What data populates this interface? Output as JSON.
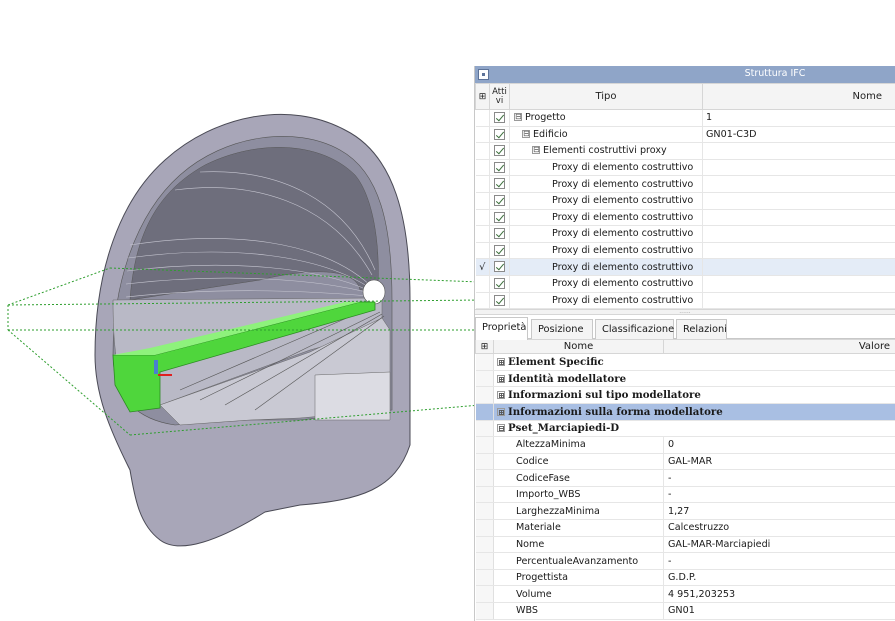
{
  "panel": {
    "title": "Struttura IFC",
    "tree_headers": {
      "active": "Atti\nvi",
      "type": "Tipo",
      "name": "Nome"
    },
    "tree_rows": [
      {
        "marker": "",
        "type": "Progetto",
        "name": "1",
        "expander": "⊟",
        "selected": false
      },
      {
        "marker": "",
        "type": "Edificio",
        "name": "GN01-C3D",
        "expander": "⊟",
        "selected": false
      },
      {
        "marker": "",
        "type": "Elementi costruttivi proxy",
        "name": "",
        "expander": "⊟",
        "selected": false
      },
      {
        "marker": "",
        "type": "Proxy di elemento costruttivo",
        "name": "",
        "expander": "",
        "selected": false
      },
      {
        "marker": "",
        "type": "Proxy di elemento costruttivo",
        "name": "",
        "expander": "",
        "selected": false
      },
      {
        "marker": "",
        "type": "Proxy di elemento costruttivo",
        "name": "",
        "expander": "",
        "selected": false
      },
      {
        "marker": "",
        "type": "Proxy di elemento costruttivo",
        "name": "",
        "expander": "",
        "selected": false
      },
      {
        "marker": "",
        "type": "Proxy di elemento costruttivo",
        "name": "",
        "expander": "",
        "selected": false
      },
      {
        "marker": "",
        "type": "Proxy di elemento costruttivo",
        "name": "",
        "expander": "",
        "selected": false
      },
      {
        "marker": "√",
        "type": "Proxy di elemento costruttivo",
        "name": "",
        "expander": "",
        "selected": true
      },
      {
        "marker": "",
        "type": "Proxy di elemento costruttivo",
        "name": "",
        "expander": "",
        "selected": false
      },
      {
        "marker": "",
        "type": "Proxy di elemento costruttivo",
        "name": "",
        "expander": "",
        "selected": false
      }
    ],
    "splitter_grip": "......",
    "tabs": [
      "Proprietà",
      "Posizione",
      "Classificazione",
      "Relazioni"
    ],
    "props_headers": {
      "name": "Nome",
      "value": "Valore"
    },
    "groups": [
      {
        "label": "Element Specific",
        "expander": "⊞",
        "selected": false
      },
      {
        "label": "Identità modellatore",
        "expander": "⊞",
        "selected": false
      },
      {
        "label": "Informazioni sul tipo modellatore",
        "expander": "⊞",
        "selected": false
      },
      {
        "label": "Informazioni sulla forma modellatore",
        "expander": "⊞",
        "selected": true
      },
      {
        "label": "Pset_Marciapiedi-D",
        "expander": "⊟",
        "selected": false
      }
    ],
    "properties": [
      {
        "name": "AltezzaMinima",
        "value": "0"
      },
      {
        "name": "Codice",
        "value": "GAL-MAR"
      },
      {
        "name": "CodiceFase",
        "value": "-"
      },
      {
        "name": "Importo_WBS",
        "value": "-"
      },
      {
        "name": "LarghezzaMinima",
        "value": "1,27"
      },
      {
        "name": "Materiale",
        "value": "Calcestruzzo"
      },
      {
        "name": "Nome",
        "value": "GAL-MAR-Marciapiedi"
      },
      {
        "name": "PercentualeAvanzamento",
        "value": "-"
      },
      {
        "name": "Progettista",
        "value": "G.D.P."
      },
      {
        "name": "Volume",
        "value": "4 951,203253"
      },
      {
        "name": "WBS",
        "value": "GN01"
      }
    ]
  },
  "colors": {
    "titlebar": "#8fa5c8",
    "selected_group": "#a9bfe3",
    "selected_row": "#e4ecf7",
    "tunnel_shell": "#a8a6b8",
    "highlight": "#4fd63c",
    "guide_lines": "#2e9e2e"
  }
}
